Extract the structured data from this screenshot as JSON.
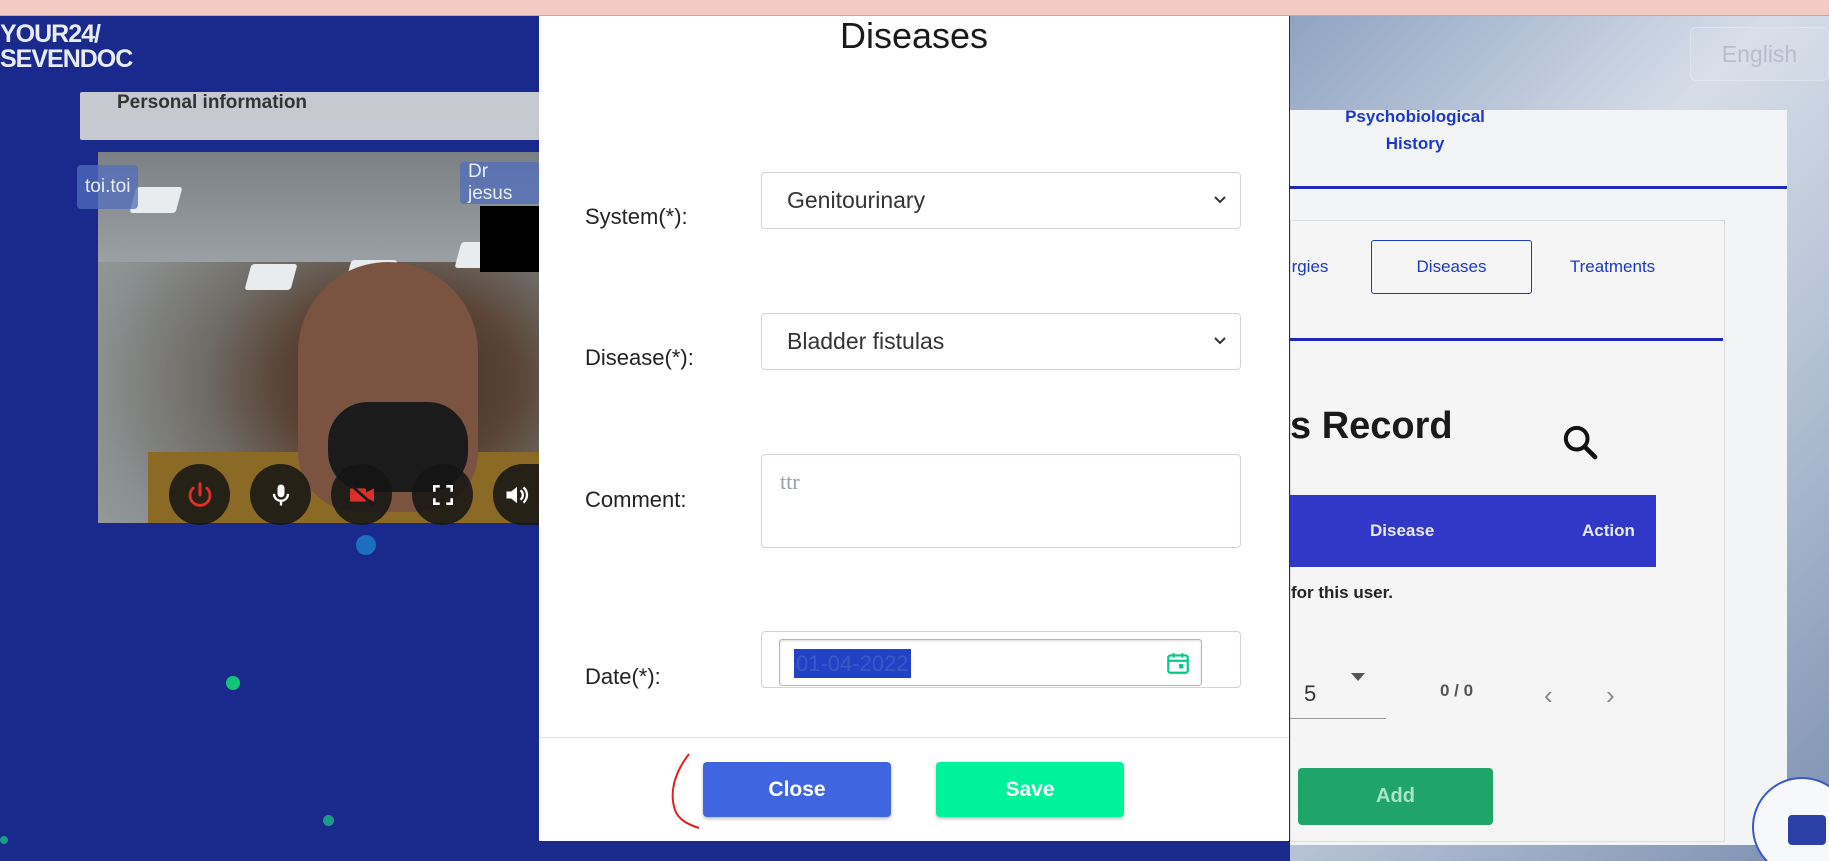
{
  "background": {
    "logo": {
      "line1": "YOUR24/",
      "line2": "SEVENDOC"
    },
    "language": "English",
    "personal_info": "Personal information",
    "video": {
      "patient_tag": "toi.toi",
      "doctor_tag": "Dr jesus",
      "controls": [
        "power-icon",
        "microphone-icon",
        "camera-off-icon",
        "fullscreen-icon",
        "volume-icon"
      ]
    },
    "history_link": {
      "line1": "Psychobiological",
      "line2": "History"
    },
    "tabs": {
      "allergies": "rgies",
      "diseases": "Diseases",
      "treatments": "Treatments"
    },
    "record_title": "s Record",
    "table_headers": {
      "disease": "Disease",
      "action": "Action"
    },
    "no_data_text": "for this user.",
    "pager": {
      "page_size": "5",
      "count": "0 / 0"
    },
    "add_label": "Add"
  },
  "modal": {
    "title": "Diseases",
    "system": {
      "label": "System(*):",
      "value": "Genitourinary"
    },
    "disease": {
      "label": "Disease(*):",
      "value": "Bladder fistulas"
    },
    "comment": {
      "label": "Comment:",
      "placeholder": "ttr"
    },
    "date": {
      "label": "Date(*):",
      "value": "01-04-2022"
    },
    "close_label": "Close",
    "save_label": "Save"
  },
  "colors": {
    "brand_blue": "#1a2a8c",
    "close_button": "#3f66e0",
    "save_button": "#00f29a",
    "add_button": "#1fa56a",
    "table_header": "#3138c7"
  }
}
